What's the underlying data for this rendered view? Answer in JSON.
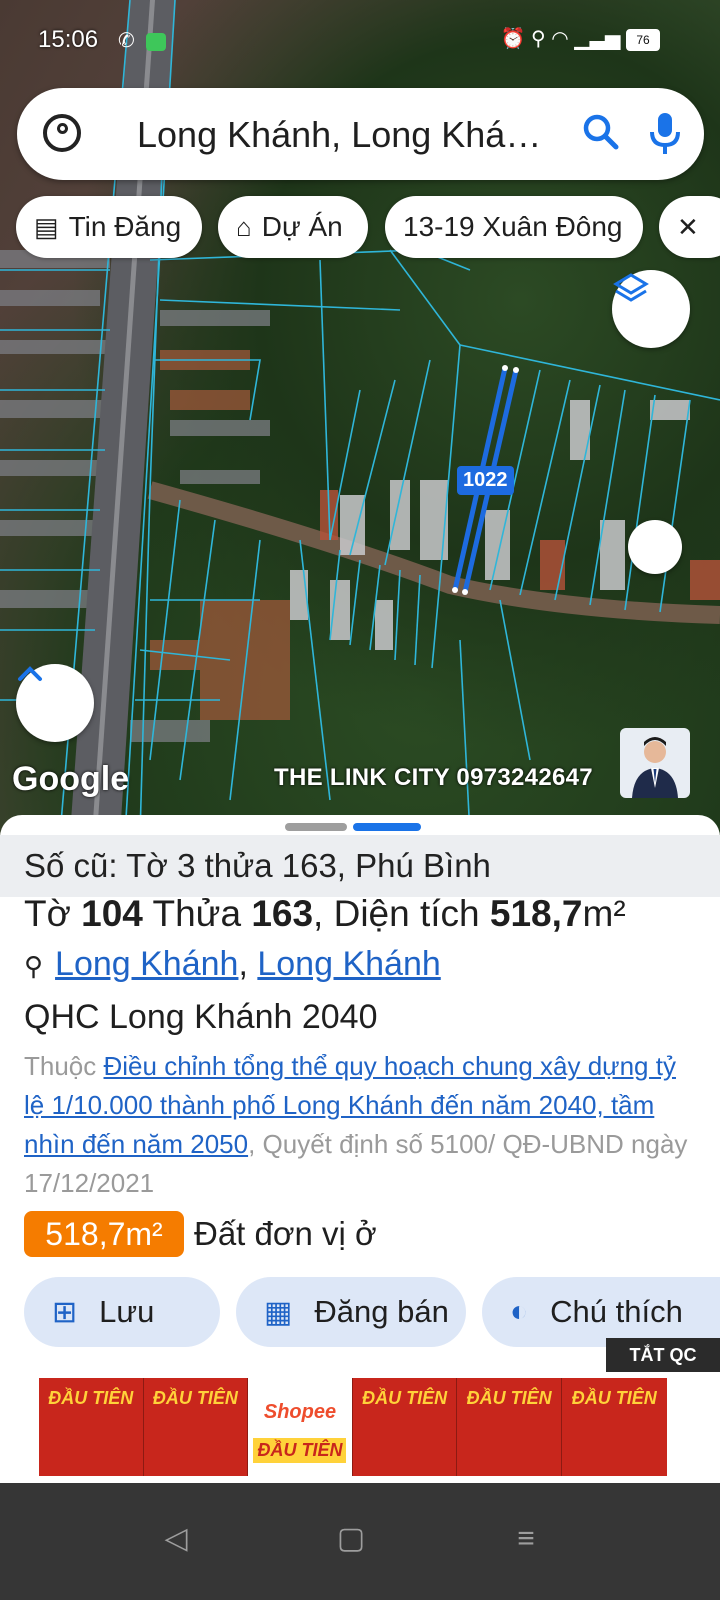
{
  "status_bar": {
    "time": "15:06",
    "battery": "76"
  },
  "search": {
    "text": "Long Khánh, Long Khá…"
  },
  "chips": [
    {
      "label": "Tin Đăng",
      "icon": "listing-icon"
    },
    {
      "label": "Dự Án",
      "icon": "building-icon"
    },
    {
      "label": "13-19 Xuân Đông",
      "icon": ""
    }
  ],
  "map": {
    "plot_number": "1022",
    "google": "Google",
    "watermark": "THE LINK CITY 0973242647"
  },
  "sheet": {
    "old_info": "Số cũ: Tờ 3 thửa 163, Phú Bình",
    "title": {
      "sheet_word": "Tờ ",
      "sheet_no": "104",
      "plot_word": " Thửa ",
      "plot_no": "163",
      "area_word": ", Diện tích ",
      "area_value": "518,7",
      "area_unit": "m²"
    },
    "location": {
      "ward": "Long Khánh",
      "sep": ", ",
      "city": "Long Khánh"
    },
    "plan_name": "QHC Long Khánh 2040",
    "plan_prefix": "Thuộc ",
    "plan_link": "Điều chỉnh tổng thể quy hoạch chung xây dựng tỷ lệ 1/10.000 thành phố Long Khánh đến năm 2040, tầm nhìn đến năm 2050",
    "plan_suffix": ", Quyết định số 5100/ QĐ-UBND ngày 17/12/2021",
    "area_badge": "518,7m²",
    "land_use": "Đất đơn vị ở",
    "actions": [
      {
        "label": "Lưu"
      },
      {
        "label": "Đăng bán"
      },
      {
        "label": "Chú thích"
      }
    ]
  },
  "ad": {
    "close_label": "TẮT QC",
    "tile_text": "ĐẦU TIÊN",
    "shop_text": "Shopee",
    "shop_sub": "ĐẦU TIÊN"
  },
  "colors": {
    "accent": "#1f63c6",
    "badge": "#f57c00",
    "plot_highlight": "#1d6be0",
    "parcel_lines": "#2fb6d9"
  }
}
